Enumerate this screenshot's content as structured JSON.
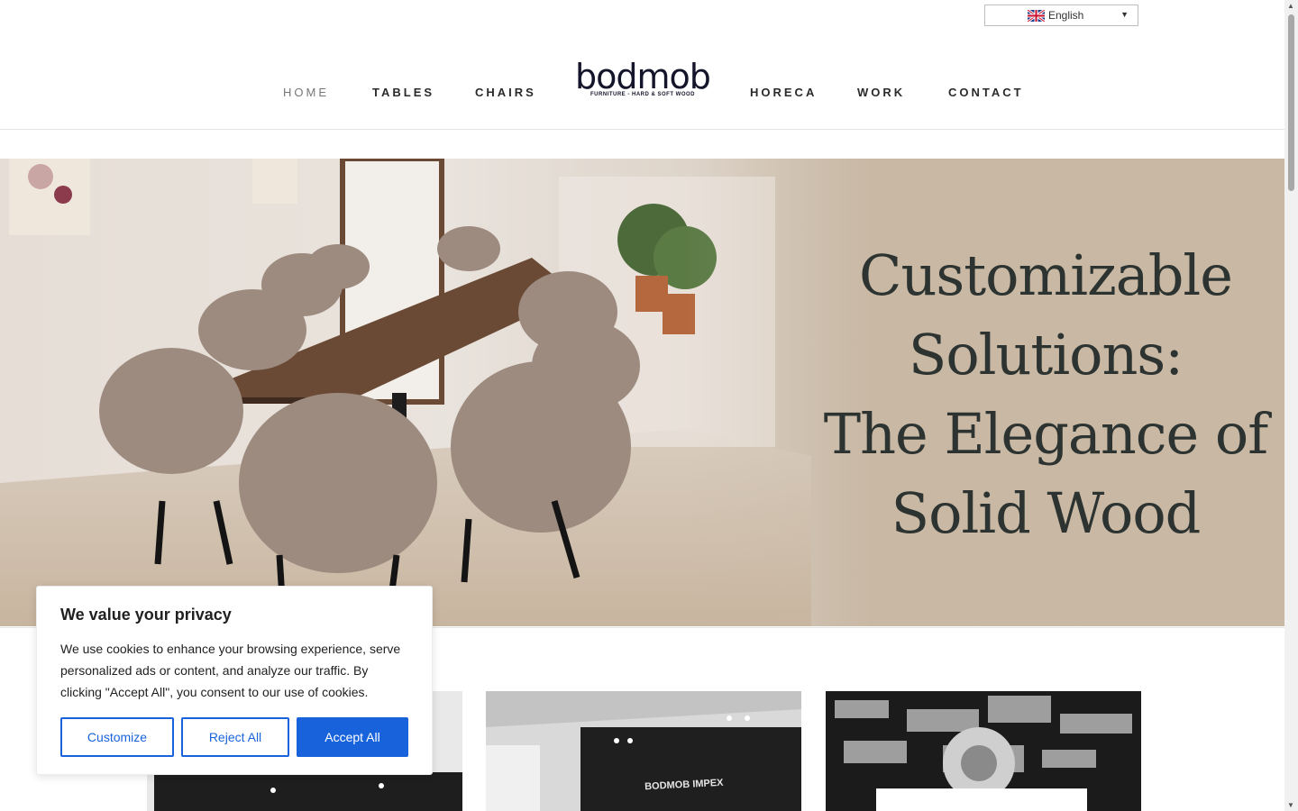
{
  "language": {
    "selected": "English"
  },
  "nav": {
    "home": "HOME",
    "tables": "TABLES",
    "chairs": "CHAIRS",
    "horeca": "HORECA",
    "work": "WORK",
    "contact": "CONTACT"
  },
  "logo": {
    "word": "bodmob",
    "subtitle": "FURNITURE - HARD & SOFT WOOD"
  },
  "hero": {
    "lines": [
      "Customizable",
      "Solutions:",
      "The Elegance of",
      "Solid Wood"
    ]
  },
  "cards": {
    "booth_sign": "BODMOB IMPEX"
  },
  "cookie": {
    "title": "We value your privacy",
    "text": "We use cookies to enhance your browsing experience, serve personalized ads or content, and analyze our traffic. By clicking \"Accept All\", you consent to our use of cookies.",
    "customize": "Customize",
    "reject": "Reject All",
    "accept": "Accept All"
  },
  "colors": {
    "accent": "#1863dc",
    "hero_bg": "#c8b8a4",
    "hero_text": "#2c3330"
  }
}
